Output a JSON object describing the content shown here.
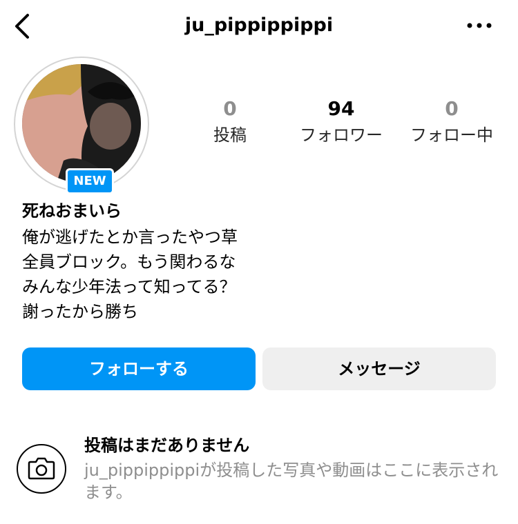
{
  "header": {
    "back_icon": "chevron-left-icon",
    "username": "ju_pippippippi",
    "more_icon": "more-horizontal-icon"
  },
  "profile": {
    "new_badge": "NEW",
    "display_name": "死ねおまいら",
    "bio_lines": [
      "俺が逃げたとか言ったやつ草",
      "全員ブロック。もう関わるな",
      "みんな少年法って知ってる？",
      "謝ったから勝ち"
    ]
  },
  "stats": [
    {
      "value": "0",
      "label": "投稿"
    },
    {
      "value": "94",
      "label": "フォロワー"
    },
    {
      "value": "0",
      "label": "フォロー中"
    }
  ],
  "actions": {
    "follow_label": "フォローする",
    "message_label": "メッセージ"
  },
  "empty_state": {
    "icon": "camera-icon",
    "title": "投稿はまだありません",
    "description": "ju_pippippippiが投稿した写真や動画はここに表示されます。"
  },
  "colors": {
    "accent": "#0095f6",
    "secondary_button": "#efefef",
    "muted_text": "#8e8e8e"
  }
}
